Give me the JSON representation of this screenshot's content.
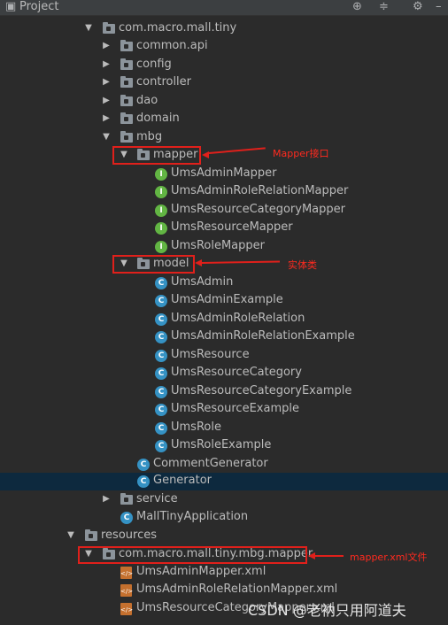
{
  "header": {
    "title": "Project"
  },
  "tree": [
    {
      "label": "com.macro.mall.tiny",
      "icon": "folder"
    },
    {
      "label": "common.api",
      "icon": "folder"
    },
    {
      "label": "config",
      "icon": "folder"
    },
    {
      "label": "controller",
      "icon": "folder"
    },
    {
      "label": "dao",
      "icon": "folder"
    },
    {
      "label": "domain",
      "icon": "folder"
    },
    {
      "label": "mbg",
      "icon": "folder"
    },
    {
      "label": "mapper",
      "icon": "folder"
    },
    {
      "label": "UmsAdminMapper",
      "icon": "interface"
    },
    {
      "label": "UmsAdminRoleRelationMapper",
      "icon": "interface"
    },
    {
      "label": "UmsResourceCategoryMapper",
      "icon": "interface"
    },
    {
      "label": "UmsResourceMapper",
      "icon": "interface"
    },
    {
      "label": "UmsRoleMapper",
      "icon": "interface"
    },
    {
      "label": "model",
      "icon": "folder"
    },
    {
      "label": "UmsAdmin",
      "icon": "class"
    },
    {
      "label": "UmsAdminExample",
      "icon": "class"
    },
    {
      "label": "UmsAdminRoleRelation",
      "icon": "class"
    },
    {
      "label": "UmsAdminRoleRelationExample",
      "icon": "class"
    },
    {
      "label": "UmsResource",
      "icon": "class"
    },
    {
      "label": "UmsResourceCategory",
      "icon": "class"
    },
    {
      "label": "UmsResourceCategoryExample",
      "icon": "class"
    },
    {
      "label": "UmsResourceExample",
      "icon": "class"
    },
    {
      "label": "UmsRole",
      "icon": "class"
    },
    {
      "label": "UmsRoleExample",
      "icon": "class"
    },
    {
      "label": "CommentGenerator",
      "icon": "class"
    },
    {
      "label": "Generator",
      "icon": "class-runnable"
    },
    {
      "label": "service",
      "icon": "folder"
    },
    {
      "label": "MallTinyApplication",
      "icon": "spring-app"
    },
    {
      "label": "resources",
      "icon": "resources-folder"
    },
    {
      "label": "com.macro.mall.tiny.mbg.mapper",
      "icon": "folder"
    },
    {
      "label": "UmsAdminMapper.xml",
      "icon": "xml-file"
    },
    {
      "label": "UmsAdminRoleRelationMapper.xml",
      "icon": "xml-file"
    },
    {
      "label": "UmsResourceCategoryMapper.xml",
      "icon": "xml-file"
    }
  ],
  "annotations": {
    "mapper": "Mapper接口",
    "model": "实体类",
    "xml": "mapper.xml文件"
  },
  "watermark": "CSDN @老衲只用阿道夫",
  "colors": {
    "background": "#2b2b2b",
    "selection": "#0d293e",
    "annotation": "#ff2a1f",
    "interface_icon": "#62b543",
    "class_icon": "#3592c4",
    "xml_icon": "#c5702e"
  }
}
